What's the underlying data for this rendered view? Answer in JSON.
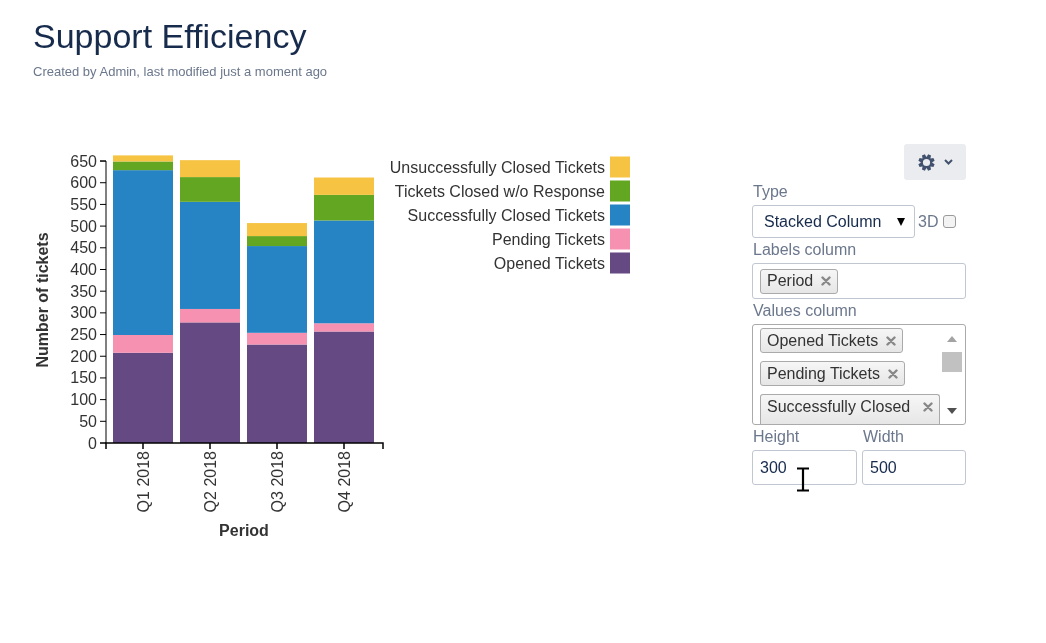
{
  "page": {
    "title": "Support Efficiency",
    "byline": "Created by Admin, last modified just a moment ago"
  },
  "chart": {
    "chart_data": {
      "type": "bar",
      "orientation": "vertical",
      "stacked": true,
      "legend": "right",
      "xlabel": "Period",
      "ylabel": "Number of tickets",
      "categories": [
        "Q1 2018",
        "Q2 2018",
        "Q3 2018",
        "Q4 2018"
      ],
      "series": [
        {
          "name": "Opened Tickets",
          "color": "#654982",
          "values": [
            208,
            278,
            227,
            257
          ]
        },
        {
          "name": "Pending Tickets",
          "color": "#f691b2",
          "values": [
            41,
            31,
            27,
            19
          ]
        },
        {
          "name": "Successfully Closed Tickets",
          "color": "#2684c4",
          "values": [
            380,
            247,
            200,
            237
          ]
        },
        {
          "name": "Tickets Closed w/o Response",
          "color": "#63a621",
          "values": [
            20,
            57,
            23,
            59
          ]
        },
        {
          "name": "Unsuccessfully Closed Tickets",
          "color": "#f6c342",
          "values": [
            14,
            39,
            30,
            40
          ]
        }
      ],
      "ylim": [
        0,
        663
      ],
      "yticks": [
        0,
        50,
        100,
        150,
        200,
        250,
        300,
        350,
        400,
        450,
        500,
        550,
        600,
        650
      ]
    }
  },
  "settings": {
    "type": {
      "label": "Type",
      "value": "Stacked Column"
    },
    "three_d": {
      "label": "3D",
      "checked": false
    },
    "labels_column": {
      "label": "Labels column",
      "tokens": [
        "Period"
      ]
    },
    "values_column": {
      "label": "Values column",
      "tokens": [
        "Opened Tickets",
        "Pending Tickets",
        "Successfully Closed"
      ]
    },
    "height": {
      "label": "Height",
      "value": "300"
    },
    "width": {
      "label": "Width",
      "value": "500"
    }
  }
}
